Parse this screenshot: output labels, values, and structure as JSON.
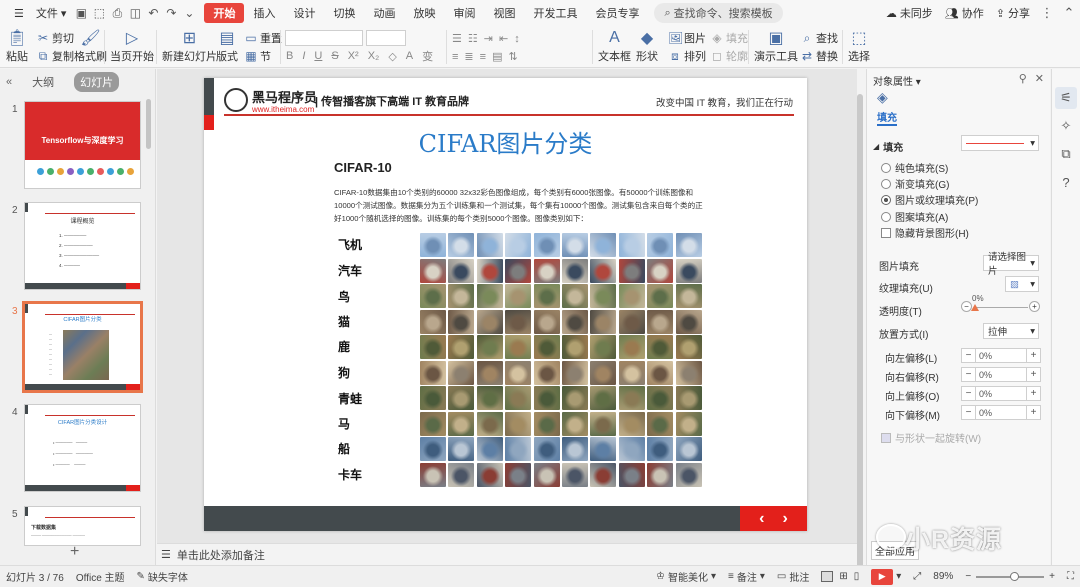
{
  "menubar": {
    "file": "文件",
    "tabs": [
      "开始",
      "插入",
      "设计",
      "切换",
      "动画",
      "放映",
      "审阅",
      "视图",
      "开发工具",
      "会员专享"
    ],
    "search_placeholder": "查找命令、搜索模板",
    "sync": "未同步",
    "collab": "协作",
    "share": "分享"
  },
  "ribbon": {
    "paste": "粘贴",
    "cut": "剪切",
    "copy": "复制",
    "format_painter": "格式刷",
    "from_current": "当页开始",
    "new_slide": "新建幻灯片",
    "layout": "版式",
    "section": "节",
    "reset": "重置",
    "textbox": "文本框",
    "shape": "形状",
    "picture": "图片",
    "fill": "填充",
    "arrange": "排列",
    "outline": "轮廓",
    "find": "查找",
    "replace": "替换",
    "presentation_tools": "演示工具",
    "select": "选择"
  },
  "leftpanel": {
    "tab_outline": "大纲",
    "tab_slides": "幻灯片",
    "slide_numbers": [
      "1",
      "2",
      "3",
      "4",
      "5"
    ],
    "thumb1_title": "Tensorflow与深度学习",
    "thumb2_title": "课程概览",
    "thumb3_title": "CIFAR图片分类",
    "thumb4_title": "CIFAR图片分类设计",
    "thumb5_title": "下载数据集"
  },
  "slide": {
    "brand": "黑马程序员",
    "url": "www.itheima.com",
    "tagline": "| 传智播客旗下高端 IT 教育品牌",
    "slogan": "改变中国 IT 教育，我们正在行动",
    "title": "CIFAR图片分类",
    "subtitle": "CIFAR-10",
    "description": "CIFAR-10数据集由10个类别的60000 32x32彩色图像组成，每个类别有6000张图像。有50000个训练图像和10000个测试图像。数据集分为五个训练集和一个测试集，每个集有10000个图像。测试集包含来自每个类的正好1000个随机选择的图像。训练集的每个类别5000个图像。图像类别如下：",
    "classes": [
      "飞机",
      "汽车",
      "鸟",
      "猫",
      "鹿",
      "狗",
      "青蛙",
      "马",
      "船",
      "卡车"
    ]
  },
  "notes": {
    "placeholder": "单击此处添加备注"
  },
  "propanel": {
    "title": "对象属性",
    "fill_tab": "填充",
    "fill_section": "填充",
    "opt_solid": "纯色填充(S)",
    "opt_gradient": "渐变填充(G)",
    "opt_picture": "图片或纹理填充(P)",
    "opt_pattern": "图案填充(A)",
    "hide_bg": "隐藏背景图形(H)",
    "pic_fill_label": "图片填充",
    "pic_fill_value": "请选择图片",
    "texture_label": "纹理填充(U)",
    "transparency_label": "透明度(T)",
    "transparency_value": "0%",
    "placement_label": "放置方式(I)",
    "placement_value": "拉伸",
    "offset_left": "向左偏移(L)",
    "offset_right": "向右偏移(R)",
    "offset_up": "向上偏移(O)",
    "offset_down": "向下偏移(M)",
    "offset_value": "0%",
    "rotate_with_shape": "与形状一起旋转(W)",
    "apply_all": "全部应用"
  },
  "statusbar": {
    "slide_info": "幻灯片 3 / 76",
    "theme": "Office 主题",
    "missing_font": "缺失字体",
    "smart_beautify": "智能美化",
    "notes": "备注",
    "comments": "批注",
    "zoom": "89%"
  },
  "watermark": "小R资源",
  "colors": {
    "accent_red": "#e8453c",
    "slide_title_blue": "#2a7bc8",
    "slide_dark_bar": "#434a4d",
    "slide_red": "#e3201b"
  }
}
